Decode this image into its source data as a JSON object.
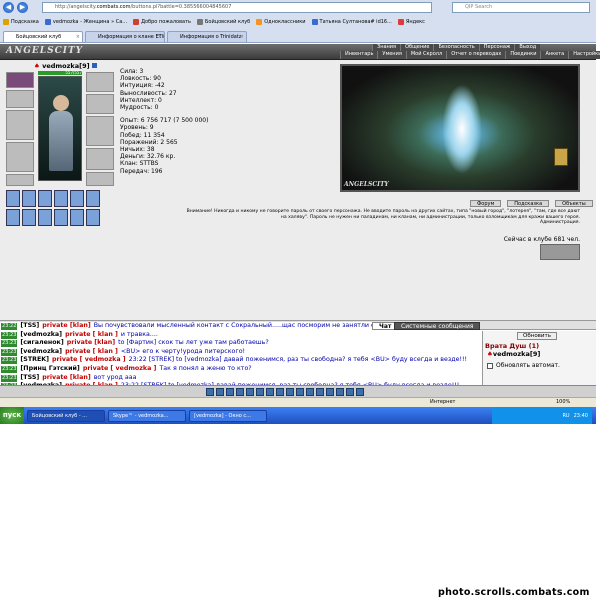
{
  "browser": {
    "url_prefix": "http://angelscity.",
    "url_domain": "combats.com",
    "url_rest": "/buttons.pl?battle=0.385566004845607",
    "search_placeholder": "QIP Search",
    "bookmarks": [
      {
        "label": "Подсказка",
        "icon": "light-icon",
        "color": "#d9a400"
      },
      {
        "label": "vedmozka - Женщина » Са...",
        "icon": "page-icon",
        "color": "#3a6ccf"
      },
      {
        "label": "Добро пожаловать",
        "icon": "page-icon",
        "color": "#d04030"
      },
      {
        "label": "Бойцовский клуб",
        "icon": "club-icon",
        "color": "#777777"
      },
      {
        "label": "Одноклассники",
        "icon": "ok-icon",
        "color": "#f7931e"
      },
      {
        "label": "Татьяна Султанова# id16...",
        "icon": "page-icon",
        "color": "#3a6ccf"
      },
      {
        "label": "Яндекс",
        "icon": "yandex-icon",
        "color": "#e03a3a"
      }
    ],
    "tabs": [
      {
        "label": "Бойцовский клуб",
        "active": true
      },
      {
        "label": "Информация о клане ETW",
        "active": false
      },
      {
        "label": "Информация о Trinidatz",
        "active": false
      }
    ]
  },
  "game": {
    "logo": "ANGELSCITY",
    "menu_top": [
      "Знания",
      "Общение",
      "Безопасность",
      "Персонаж",
      "Выход"
    ],
    "menu_bottom": [
      "Инвентарь",
      "Умения",
      "Мой Скролл",
      "Отчет о переводах",
      "Поединки",
      "Анкета",
      "Настройки"
    ],
    "character": {
      "name": "vedmozka",
      "level": "[9]",
      "hp": "557/557"
    },
    "stats": [
      {
        "text": "Сила: 3"
      },
      {
        "text": "Ловкость: 90"
      },
      {
        "text": "Интуиция: -42"
      },
      {
        "text": "Выносливость: 27"
      },
      {
        "text": "Интеллект: 0"
      },
      {
        "text": "Мудрость: 0"
      }
    ],
    "stats2": [
      {
        "text": "Опыт: 6 756 717 (7 500 000)"
      },
      {
        "text": "Уровень: 9"
      },
      {
        "text": "Побед: 11 354"
      },
      {
        "text": "Поражений: 2 565"
      },
      {
        "text": "Ничьих: 38"
      },
      {
        "text": "Деньги: 32.76 кр."
      },
      {
        "text": "Клан: STTBS"
      },
      {
        "text": "Передач: 196"
      }
    ],
    "image_tag": "ANGELSCITY",
    "buttons": [
      "Форум",
      "Подсказка",
      "Объекты"
    ],
    "warning": "Внимание! Никогда и никому не говорите пароль от своего персонажа. Не вводите пароль на других сайтах, типа \"новый город\", \"лотерея\", \"там, где все дают на халяву\". Пароль не нужен ни паладинам, ни кланам, ни администрации, только взломщикам для кражи вашего героя.",
    "admin": "Администрация.",
    "online": "Сейчас в клубе 681 чел."
  },
  "chat": {
    "tab_chat": "Чат",
    "tab_system": "Системные сообщения",
    "lines": [
      {
        "time": "23:22",
        "nick": "[TSS]",
        "priv": "private [klan]",
        "text": "Вы почувствовали мысленный контакт с Сокральный.....щас посморим не занятли он"
      },
      {
        "time": "23:23",
        "nick": "[vedmozka]",
        "priv": "private [ klan ]",
        "text": "и травка...."
      },
      {
        "time": "23:23",
        "nick": "[сигаленок]",
        "priv": "private [klan]",
        "text": "to [Фартик] скок ты лет уже там работаешь?"
      },
      {
        "time": "23:23",
        "nick": "[vedmozka]",
        "priv": "private [ klan ]",
        "text": "<BU> его к черту!урода питерского!"
      },
      {
        "time": "23:23",
        "nick": "[STREK]",
        "priv": "private [ vedmozka ]",
        "text": "23:22 [STREK] to [vedmozka] давай поженимся, раз ты свободна? я тебя <BU> буду всегда и везде!!!"
      },
      {
        "time": "23:23",
        "nick": "[Принц Гэтский]",
        "priv": "private [ vedmozka ]",
        "text": "Так я понял а женю то кто?"
      },
      {
        "time": "23:23",
        "nick": "[TSS]",
        "priv": "private [klan]",
        "text": "вот урод ааа"
      },
      {
        "time": "23:23",
        "nick": "[vedmozka]",
        "priv": "private [ klan ]",
        "text": "23:22 [STREK] to [vedmozka] давай поженимся, раз ты свободна? я тебя <BU> буду всегда и везде!!!"
      }
    ],
    "refresh": "Обновить",
    "room": "Врата Душ (1)",
    "room_user": "vedmozka[9]",
    "auto_refresh": "Обновлять автомат."
  },
  "status": {
    "text": "Интернет",
    "zoom": "100%"
  },
  "taskbar": {
    "start": "пуск",
    "items": [
      {
        "label": "Бойцовский клуб - ...",
        "active": true
      },
      {
        "label": "Skype™ - vedmozka...",
        "active": false
      },
      {
        "label": "[vedmozka] - Окно с...",
        "active": false
      }
    ],
    "lang": "RU",
    "clock": "23:40"
  },
  "watermark": "photo.scrolls.combats.com"
}
